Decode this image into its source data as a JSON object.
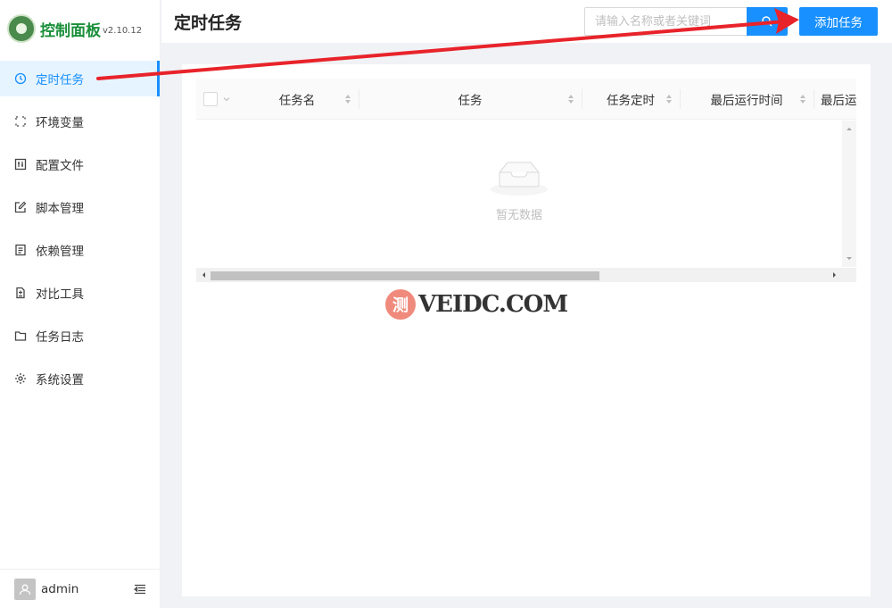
{
  "brand": {
    "title": "控制面板",
    "version": "v2.10.12"
  },
  "sidebar": {
    "items": [
      {
        "label": "定时任务",
        "icon": "clock-icon",
        "active": true
      },
      {
        "label": "环境变量",
        "icon": "env-variable-icon",
        "active": false
      },
      {
        "label": "配置文件",
        "icon": "config-file-icon",
        "active": false
      },
      {
        "label": "脚本管理",
        "icon": "edit-icon",
        "active": false
      },
      {
        "label": "依赖管理",
        "icon": "dependency-icon",
        "active": false
      },
      {
        "label": "对比工具",
        "icon": "diff-icon",
        "active": false
      },
      {
        "label": "任务日志",
        "icon": "folder-icon",
        "active": false
      },
      {
        "label": "系统设置",
        "icon": "gear-icon",
        "active": false
      }
    ],
    "footer": {
      "username": "admin"
    }
  },
  "header": {
    "title": "定时任务",
    "search_placeholder": "请输入名称或者关键词",
    "add_button": "添加任务"
  },
  "table": {
    "columns": [
      "任务名",
      "任务",
      "任务定时",
      "最后运行时间",
      "最后运"
    ],
    "rows": [],
    "empty_text": "暂无数据"
  },
  "watermark": {
    "badge": "测",
    "text": "VEIDC.COM"
  },
  "colors": {
    "primary": "#1890ff",
    "annotation_arrow": "#e8232a",
    "brand_green": "#1a8f3a"
  }
}
